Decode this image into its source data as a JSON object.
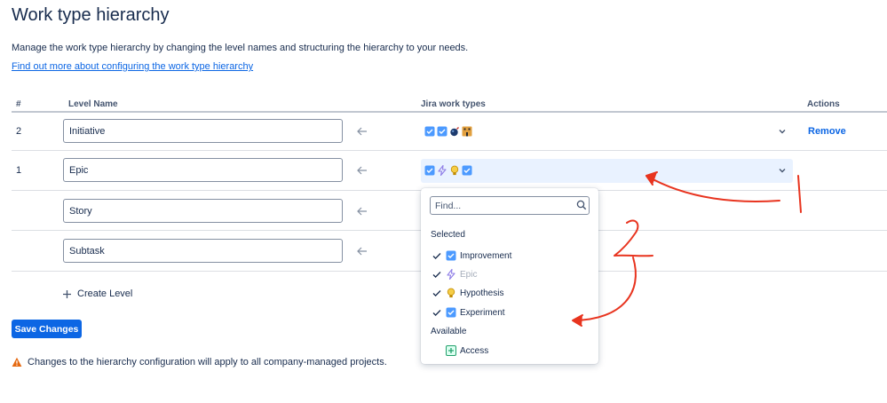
{
  "page": {
    "title": "Work type hierarchy",
    "description": "Manage the work type hierarchy by changing the level names and structuring the hierarchy to your needs.",
    "link": "Find out more about configuring the work type hierarchy"
  },
  "table": {
    "headers": {
      "num": "#",
      "level_name": "Level Name",
      "jira_types": "Jira work types",
      "actions": "Actions"
    },
    "rows": [
      {
        "num": "2",
        "name": "Initiative",
        "types": [
          "task-icon",
          "task-icon",
          "bomb-icon",
          "building-icon"
        ],
        "action": "Remove"
      },
      {
        "num": "1",
        "name": "Epic",
        "types": [
          "task-icon",
          "lightning-icon",
          "bulb-icon",
          "task-icon"
        ],
        "action": ""
      },
      {
        "num": "",
        "name": "Story",
        "types": [],
        "action": ""
      },
      {
        "num": "",
        "name": "Subtask",
        "types": [],
        "action": ""
      }
    ]
  },
  "create_level": "Create Level",
  "save_button": "Save Changes",
  "warning": "Changes to the hierarchy configuration will apply to all company-managed projects.",
  "dropdown": {
    "placeholder": "Find...",
    "selected_label": "Selected",
    "selected": [
      {
        "label": "Improvement",
        "icon": "task-icon",
        "checked": true,
        "disabled": false
      },
      {
        "label": "Epic",
        "icon": "lightning-icon",
        "checked": true,
        "disabled": true
      },
      {
        "label": "Hypothesis",
        "icon": "bulb-icon",
        "checked": true,
        "disabled": false
      },
      {
        "label": "Experiment",
        "icon": "task-icon",
        "checked": true,
        "disabled": false
      }
    ],
    "available_label": "Available",
    "available": [
      {
        "label": "Access",
        "icon": "plus-square-icon"
      }
    ]
  },
  "annotations": {
    "marks": [
      "1",
      "2"
    ],
    "color": "#e8341f"
  },
  "colors": {
    "brand": "#0c66e4",
    "select_bg": "#e9f2ff",
    "warning": "#e56910",
    "lightning": "#8f7ee7",
    "bulb": "#e2b203"
  }
}
